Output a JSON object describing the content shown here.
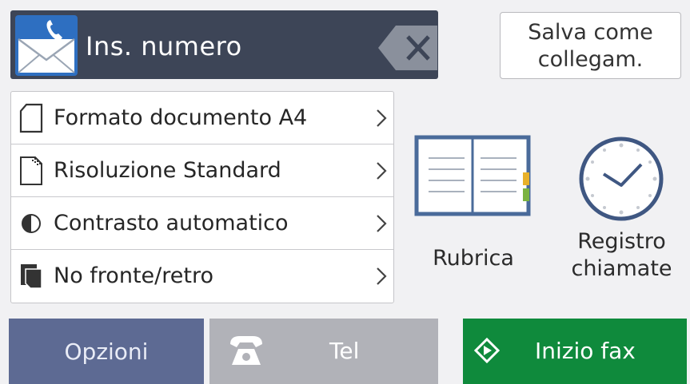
{
  "header": {
    "number_label": "Ins. numero",
    "save_shortcut_line1": "Salva come",
    "save_shortcut_line2": "collegam.",
    "fax_icon": "fax-envelope-icon",
    "backspace_icon": "backspace-icon"
  },
  "settings": [
    {
      "label": "Formato documento A4",
      "icon": "document-size-icon"
    },
    {
      "label": "Risoluzione Standard",
      "icon": "resolution-icon"
    },
    {
      "label": "Contrasto automatico",
      "icon": "contrast-icon"
    },
    {
      "label": "No fronte/retro",
      "icon": "duplex-icon"
    }
  ],
  "shortcuts": {
    "address_book_label": "Rubrica",
    "call_history_line1": "Registro",
    "call_history_line2": "chiamate"
  },
  "bottom_bar": {
    "options_label": "Opzioni",
    "tel_label": "Tel",
    "start_label": "Inizio fax"
  },
  "colors": {
    "header_bg": "#3d4557",
    "options_bg": "#5d6a93",
    "tel_bg": "#b1b2b8",
    "start_bg": "#0f8a3c"
  }
}
